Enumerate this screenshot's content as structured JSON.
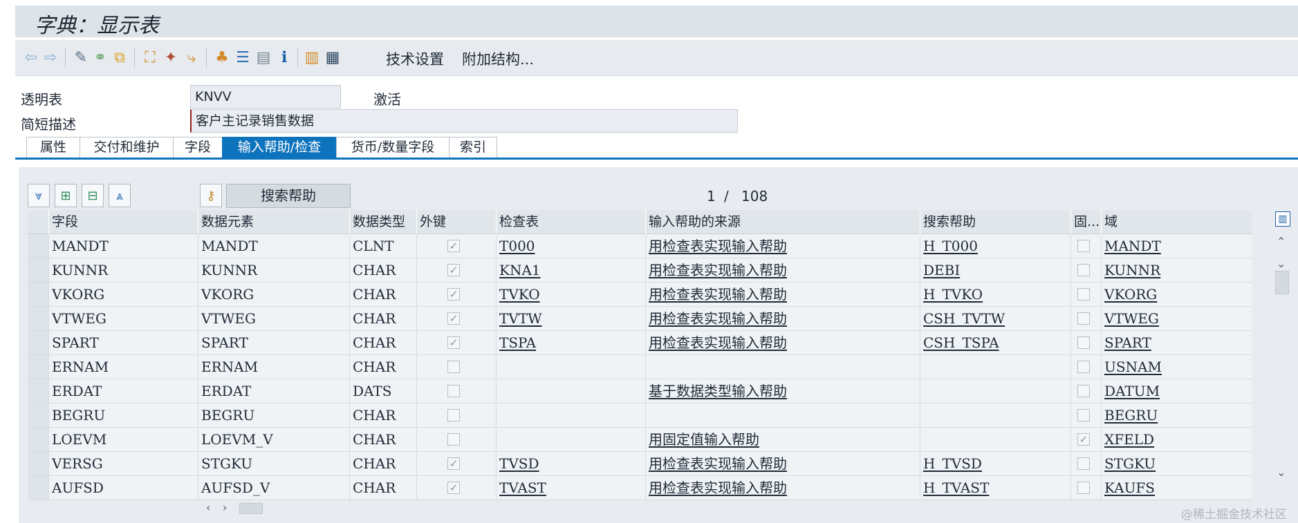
{
  "window": {
    "title": "字典：显示表"
  },
  "toolbar": {
    "icons": [
      "back-icon",
      "forward-icon",
      "display-change-icon",
      "other-object-icon",
      "where-used-icon",
      "activate-icon",
      "check-icon",
      "wand-icon",
      "navigate-icon",
      "hierarchy-icon",
      "layout-icon",
      "list-icon",
      "info-icon",
      "layout-icon",
      "table-view-icon"
    ],
    "technical_settings": "技术设置",
    "append_structures": "附加结构..."
  },
  "header": {
    "transparent_table_label": "透明表",
    "table_name": "KNVV",
    "status": "激活",
    "short_desc_label": "简短描述",
    "short_desc": "客户主记录销售数据"
  },
  "tabs": [
    {
      "label": "属性",
      "active": false
    },
    {
      "label": "交付和维护",
      "active": false
    },
    {
      "label": "字段",
      "active": false
    },
    {
      "label": "输入帮助/检查",
      "active": true
    },
    {
      "label": "货币/数量字段",
      "active": false
    },
    {
      "label": "索引",
      "active": false
    }
  ],
  "grid_toolbar": {
    "search_help_button": "搜索帮助",
    "pager": {
      "current": "1",
      "sep": "/",
      "total": "108"
    }
  },
  "table": {
    "columns": [
      "字段",
      "数据元素",
      "数据类型",
      "外键",
      "检查表",
      "输入帮助的来源",
      "搜索帮助",
      "固...",
      "域"
    ],
    "rows": [
      {
        "field": "MANDT",
        "element": "MANDT",
        "type": "CLNT",
        "fk": true,
        "check_table": "T000",
        "source": "用检查表实现输入帮助",
        "search_help": "H_T000",
        "fixed": false,
        "domain": "MANDT"
      },
      {
        "field": "KUNNR",
        "element": "KUNNR",
        "type": "CHAR",
        "fk": true,
        "check_table": "KNA1",
        "source": "用检查表实现输入帮助",
        "search_help": "DEBI",
        "fixed": false,
        "domain": "KUNNR"
      },
      {
        "field": "VKORG",
        "element": "VKORG",
        "type": "CHAR",
        "fk": true,
        "check_table": "TVKO",
        "source": "用检查表实现输入帮助",
        "search_help": "H_TVKO",
        "fixed": false,
        "domain": "VKORG"
      },
      {
        "field": "VTWEG",
        "element": "VTWEG",
        "type": "CHAR",
        "fk": true,
        "check_table": "TVTW",
        "source": "用检查表实现输入帮助",
        "search_help": "CSH_TVTW",
        "fixed": false,
        "domain": "VTWEG"
      },
      {
        "field": "SPART",
        "element": "SPART",
        "type": "CHAR",
        "fk": true,
        "check_table": "TSPA",
        "source": "用检查表实现输入帮助",
        "search_help": "CSH_TSPA",
        "fixed": false,
        "domain": "SPART"
      },
      {
        "field": "ERNAM",
        "element": "ERNAM",
        "type": "CHAR",
        "fk": false,
        "check_table": "",
        "source": "",
        "search_help": "",
        "fixed": false,
        "domain": "USNAM"
      },
      {
        "field": "ERDAT",
        "element": "ERDAT",
        "type": "DATS",
        "fk": false,
        "check_table": "",
        "source": "基于数据类型输入帮助",
        "search_help": "",
        "fixed": false,
        "domain": "DATUM"
      },
      {
        "field": "BEGRU",
        "element": "BEGRU",
        "type": "CHAR",
        "fk": false,
        "check_table": "",
        "source": "",
        "search_help": "",
        "fixed": false,
        "domain": "BEGRU"
      },
      {
        "field": "LOEVM",
        "element": "LOEVM_V",
        "type": "CHAR",
        "fk": false,
        "check_table": "",
        "source": "用固定值输入帮助",
        "search_help": "",
        "fixed": true,
        "domain": "XFELD"
      },
      {
        "field": "VERSG",
        "element": "STGKU",
        "type": "CHAR",
        "fk": true,
        "check_table": "TVSD",
        "source": "用检查表实现输入帮助",
        "search_help": "H_TVSD",
        "fixed": false,
        "domain": "STGKU"
      },
      {
        "field": "AUFSD",
        "element": "AUFSD_V",
        "type": "CHAR",
        "fk": true,
        "check_table": "TVAST",
        "source": "用检查表实现输入帮助",
        "search_help": "H_TVAST",
        "fixed": false,
        "domain": "KAUFS"
      }
    ]
  },
  "watermark": "@稀土掘金技术社区"
}
